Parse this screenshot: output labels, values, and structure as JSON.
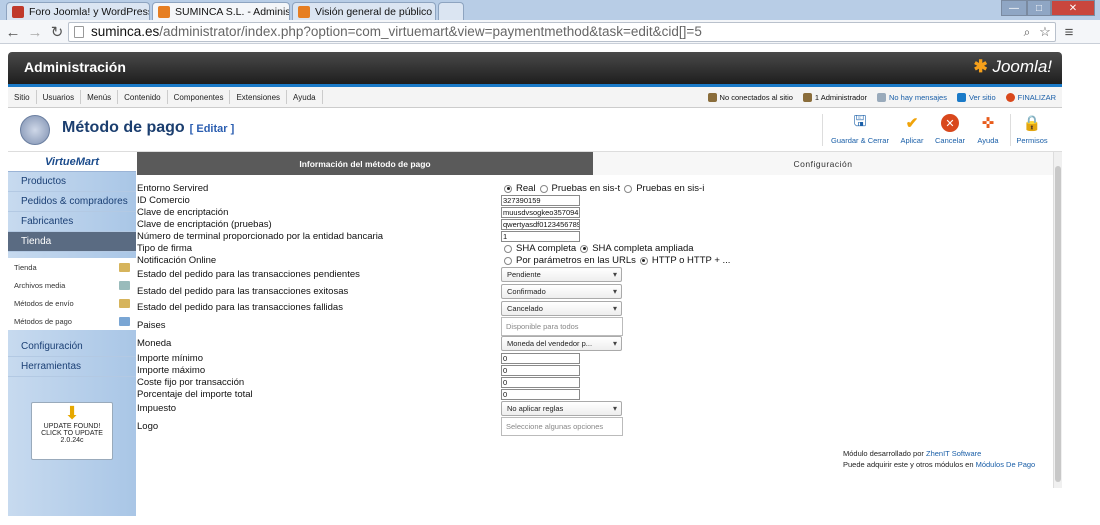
{
  "browser": {
    "tabs": [
      {
        "title": "Foro Joomla! y WordPress",
        "color": "#c0392b",
        "active": false
      },
      {
        "title": "SUMINCA S.L. - Administ",
        "color": "#e67e22",
        "active": true
      },
      {
        "title": "Visión general de público",
        "color": "#e67e22",
        "active": false
      }
    ],
    "url_host": "suminca.es",
    "url_rest": "/administrator/index.php?option=com_virtuemart&view=paymentmethod&task=edit&cid[]=5"
  },
  "header": {
    "title": "Administración",
    "logo": "Joomla!"
  },
  "menu": [
    "Sitio",
    "Usuarios",
    "Menús",
    "Contenido",
    "Componentes",
    "Extensiones",
    "Ayuda"
  ],
  "status": {
    "not_connected": "No conectados al sitio",
    "admins": "1 Administrador",
    "messages": "No hay mensajes",
    "view_site": "Ver sitio",
    "logout": "FINALIZAR"
  },
  "toolbar": {
    "title": "Método de pago",
    "edit": "[ Editar ]",
    "buttons": [
      {
        "label": "Guardar & Cerrar",
        "icon": "save-icon"
      },
      {
        "label": "Aplicar",
        "icon": "apply-icon"
      },
      {
        "label": "Cancelar",
        "icon": "cancel-icon"
      },
      {
        "label": "Ayuda",
        "icon": "help-icon"
      },
      {
        "label": "Permisos",
        "icon": "lock-icon"
      }
    ]
  },
  "sidebar": {
    "logo": "VirtueMart",
    "items": [
      "Productos",
      "Pedidos & compradores",
      "Fabricantes",
      "Tienda"
    ],
    "subitems": [
      "Tienda",
      "Archivos media",
      "Métodos de envío",
      "Métodos de pago"
    ],
    "items2": [
      "Configuración",
      "Herramientas"
    ],
    "update": [
      "UPDATE FOUND!",
      "CLICK TO UPDATE",
      "2.0.24c"
    ]
  },
  "tabs": [
    "Información del método de pago",
    "Configuración"
  ],
  "form": {
    "labels": [
      "Entorno Servired",
      "ID Comercio",
      "Clave de encriptación",
      "Clave de encriptación (pruebas)",
      "Número de terminal proporcionado por la entidad bancaria",
      "Tipo de firma",
      "Notificación Online",
      "Estado del pedido para las transacciones pendientes",
      "Estado del pedido para las transacciones exitosas",
      "Estado del pedido para las transacciones fallidas",
      "Paises",
      "Moneda",
      "Importe mínimo",
      "Importe máximo",
      "Coste fijo por transacción",
      "Porcentaje del importe total",
      "Impuesto",
      "Logo"
    ],
    "entorno": [
      "Real",
      "Pruebas en sis-t",
      "Pruebas en sis-i"
    ],
    "id_comercio": "327390159",
    "clave": "muusdvsogkeo357094",
    "clave_pruebas": "qwertyasdf0123456789",
    "terminal": "1",
    "firma": [
      "SHA completa",
      "SHA completa ampliada"
    ],
    "notificacion": [
      "Por parámetros en las URLs",
      "HTTP o HTTP + ..."
    ],
    "pendiente": "Pendiente",
    "exitosa": "Confirmado",
    "fallida": "Cancelado",
    "paises": "Disponible para todos",
    "moneda": "Moneda del vendedor p...",
    "importe_min": "0",
    "importe_max": "0",
    "coste_fijo": "0",
    "porcentaje": "0",
    "impuesto": "No aplicar reglas",
    "logo": "Seleccione algunas opciones"
  },
  "credits": {
    "line1": "Módulo desarrollado por",
    "link1": "ZhenIT Software",
    "line2": "Puede adquirir este y otros módulos en",
    "link2": "Módulos De Pago"
  }
}
